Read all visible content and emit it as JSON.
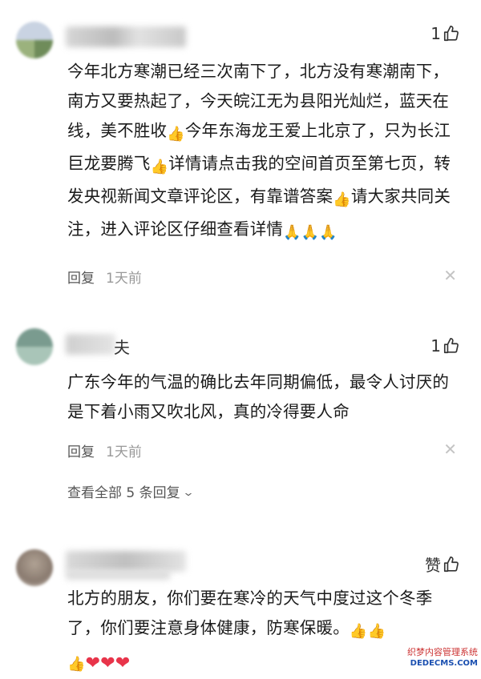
{
  "comments": [
    {
      "like_count": "1",
      "body_parts": [
        "今年北方寒潮已经三次南下了，北方没有寒潮南下，南方又要热起了，今天皖江无为县阳光灿烂，蓝天在线，美不胜收",
        "今年东海龙王爱上北京了，只为长江巨龙要腾飞",
        "详情请点击我的空间首页至第七页，转发央视新闻文章评论区，有靠谱答案",
        "请大家共同关注，进入评论区仔细查看详情"
      ],
      "reply_label": "回复",
      "time": "1天前"
    },
    {
      "like_count": "1",
      "name_fragment": "夫",
      "body": "广东今年的气温的确比去年同期偏低，最令人讨厌的是下着小雨又吹北风，真的冷得要人命",
      "reply_label": "回复",
      "time": "1天前",
      "see_all": "查看全部 5 条回复"
    },
    {
      "like_label": "赞",
      "body": "北方的朋友，你们要在寒冷的天气中度过这个冬季了，你们要注意身体健康，防寒保暖。"
    }
  ],
  "watermark": {
    "line1": "织梦内容管理系统",
    "line2": "DEDECMS.COM"
  },
  "icons": {
    "thumb": "thumbs-up-icon",
    "close": "close-icon",
    "chevron": "chevron-down-icon"
  }
}
